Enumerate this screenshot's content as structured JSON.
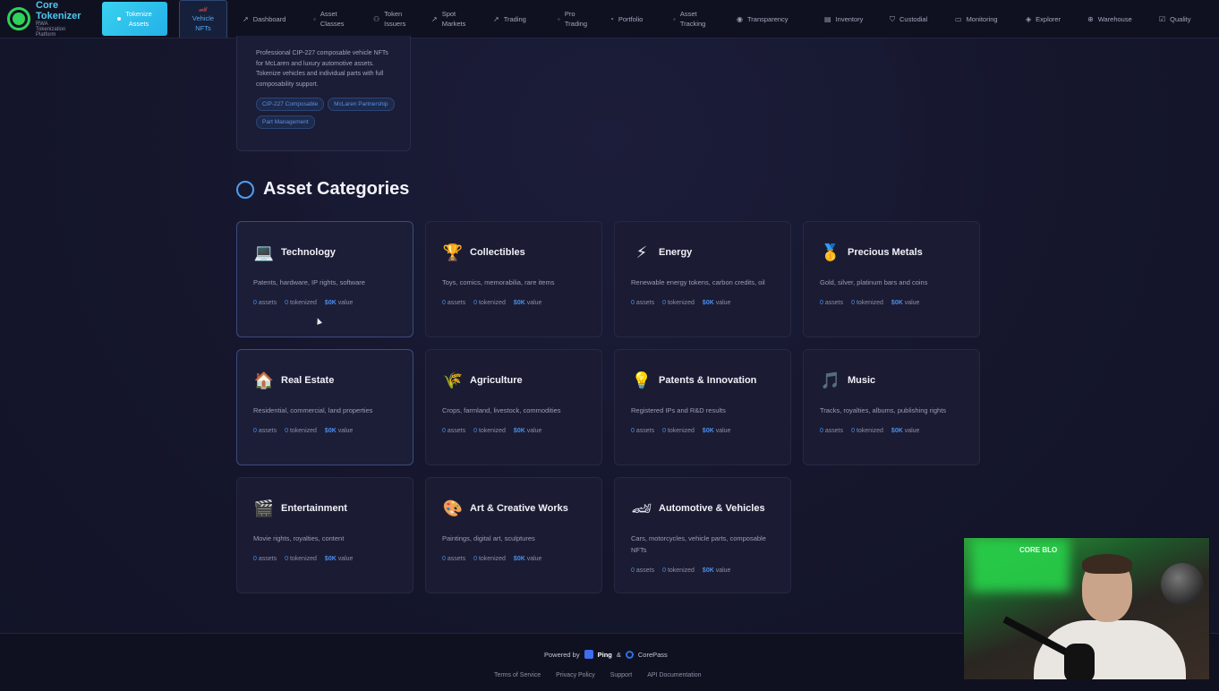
{
  "brand": {
    "name_line1": "Core",
    "name_line2": "Tokenizer",
    "sub_line1": "RWA",
    "sub_line2": "Tokenization",
    "sub_line3": "Platform",
    "logo_color": "#2fd35a"
  },
  "nav": {
    "primary": {
      "line1": "Tokenize",
      "line2": "Assets"
    },
    "active": {
      "line1": "Vehicle",
      "line2": "NFTs",
      "icon": "car-icon"
    },
    "items": [
      {
        "line1": "Dashboard",
        "line2": "",
        "icon": "chart-line-icon"
      },
      {
        "line1": "Asset",
        "line2": "Classes",
        "icon": "dot-icon"
      },
      {
        "line1": "Token",
        "line2": "Issuers",
        "icon": "user-icon"
      },
      {
        "line1": "Spot",
        "line2": "Markets",
        "icon": "trend-icon"
      },
      {
        "line1": "Trading",
        "line2": "",
        "icon": "trend-icon"
      },
      {
        "line1": "Pro",
        "line2": "Trading",
        "icon": "dot-icon"
      },
      {
        "line1": "Portfolio",
        "line2": "",
        "icon": "pie-icon"
      },
      {
        "line1": "Asset",
        "line2": "Tracking",
        "icon": "dot-icon"
      },
      {
        "line1": "Transparency",
        "line2": "",
        "icon": "eye-icon"
      },
      {
        "line1": "Inventory",
        "line2": "",
        "icon": "box-icon"
      },
      {
        "line1": "Custodial",
        "line2": "",
        "icon": "shield-icon"
      },
      {
        "line1": "Monitoring",
        "line2": "",
        "icon": "monitor-icon"
      },
      {
        "line1": "Explorer",
        "line2": "",
        "icon": "layers-icon"
      },
      {
        "line1": "Warehouse",
        "line2": "",
        "icon": "globe-icon"
      },
      {
        "line1": "Quality",
        "line2": "",
        "icon": "check-icon"
      }
    ]
  },
  "vehicle_card": {
    "description": "Professional CIP-227 composable vehicle NFTs for McLaren and luxury automotive assets. Tokenize vehicles and individual parts with full composability support.",
    "tags": [
      "CIP-227 Composable",
      "McLaren Partnership",
      "Part Management"
    ]
  },
  "section": {
    "title": "Asset Categories"
  },
  "categories": [
    {
      "icon": "💻",
      "icon_name": "laptop-icon",
      "title": "Technology",
      "desc": "Patents, hardware, IP rights, software",
      "assets": "0",
      "tokenized": "0",
      "value": "$0K"
    },
    {
      "icon": "🏆",
      "icon_name": "trophy-icon",
      "title": "Collectibles",
      "desc": "Toys, comics, memorabilia, rare items",
      "assets": "0",
      "tokenized": "0",
      "value": "$0K"
    },
    {
      "icon": "⚡",
      "icon_name": "lightning-icon",
      "title": "Energy",
      "desc": "Renewable energy tokens, carbon credits, oil",
      "assets": "0",
      "tokenized": "0",
      "value": "$0K"
    },
    {
      "icon": "🥇",
      "icon_name": "medal-icon",
      "title": "Precious Metals",
      "desc": "Gold, silver, platinum bars and coins",
      "assets": "0",
      "tokenized": "0",
      "value": "$0K"
    },
    {
      "icon": "🏠",
      "icon_name": "house-icon",
      "title": "Real Estate",
      "desc": "Residential, commercial, land properties",
      "assets": "0",
      "tokenized": "0",
      "value": "$0K"
    },
    {
      "icon": "🌾",
      "icon_name": "wheat-icon",
      "title": "Agriculture",
      "desc": "Crops, farmland, livestock, commodities",
      "assets": "0",
      "tokenized": "0",
      "value": "$0K"
    },
    {
      "icon": "💡",
      "icon_name": "lightbulb-icon",
      "title": "Patents & Innovation",
      "desc": "Registered IPs and R&D results",
      "assets": "0",
      "tokenized": "0",
      "value": "$0K"
    },
    {
      "icon": "🎵",
      "icon_name": "music-note-icon",
      "title": "Music",
      "desc": "Tracks, royalties, albums, publishing rights",
      "assets": "0",
      "tokenized": "0",
      "value": "$0K"
    },
    {
      "icon": "🎬",
      "icon_name": "clapperboard-icon",
      "title": "Entertainment",
      "desc": "Movie rights, royalties, content",
      "assets": "0",
      "tokenized": "0",
      "value": "$0K"
    },
    {
      "icon": "🎨",
      "icon_name": "palette-icon",
      "title": "Art & Creative Works",
      "desc": "Paintings, digital art, sculptures",
      "assets": "0",
      "tokenized": "0",
      "value": "$0K"
    },
    {
      "icon": "🏎",
      "icon_name": "race-car-icon",
      "title": "Automotive & Vehicles",
      "desc": "Cars, motorcycles, vehicle parts, composable NFTs",
      "assets": "0",
      "tokenized": "0",
      "value": "$0K"
    }
  ],
  "stat_labels": {
    "assets": "assets",
    "tokenized": "tokenized",
    "value": "value"
  },
  "footer": {
    "powered_by": "Powered by",
    "partner1": "Ping",
    "amp": "&",
    "partner2": "CorePass",
    "links": [
      "Terms of Service",
      "Privacy Policy",
      "Support",
      "API Documentation"
    ]
  },
  "webcam": {
    "sign_text": "CORE BLO"
  },
  "colors": {
    "accent": "#4b8ff0",
    "primary_button": "#2fc4ee",
    "background": "#16172e"
  }
}
